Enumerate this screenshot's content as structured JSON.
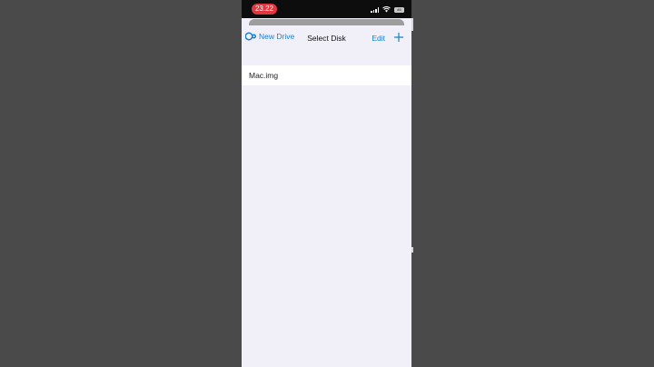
{
  "status_bar": {
    "time": "23.22",
    "battery": "85"
  },
  "nav": {
    "back_label": "New Drive",
    "title": "Select Disk",
    "edit_label": "Edit",
    "add_icon": "plus-icon",
    "app_icon": "utm-logo-icon"
  },
  "disks": [
    {
      "name": "Mac.img"
    }
  ],
  "colors": {
    "accent": "#1a7fc9",
    "time_pill": "#e0383e",
    "sheet_background": "#f1eff8",
    "outer_background": "#4a4a4a"
  }
}
